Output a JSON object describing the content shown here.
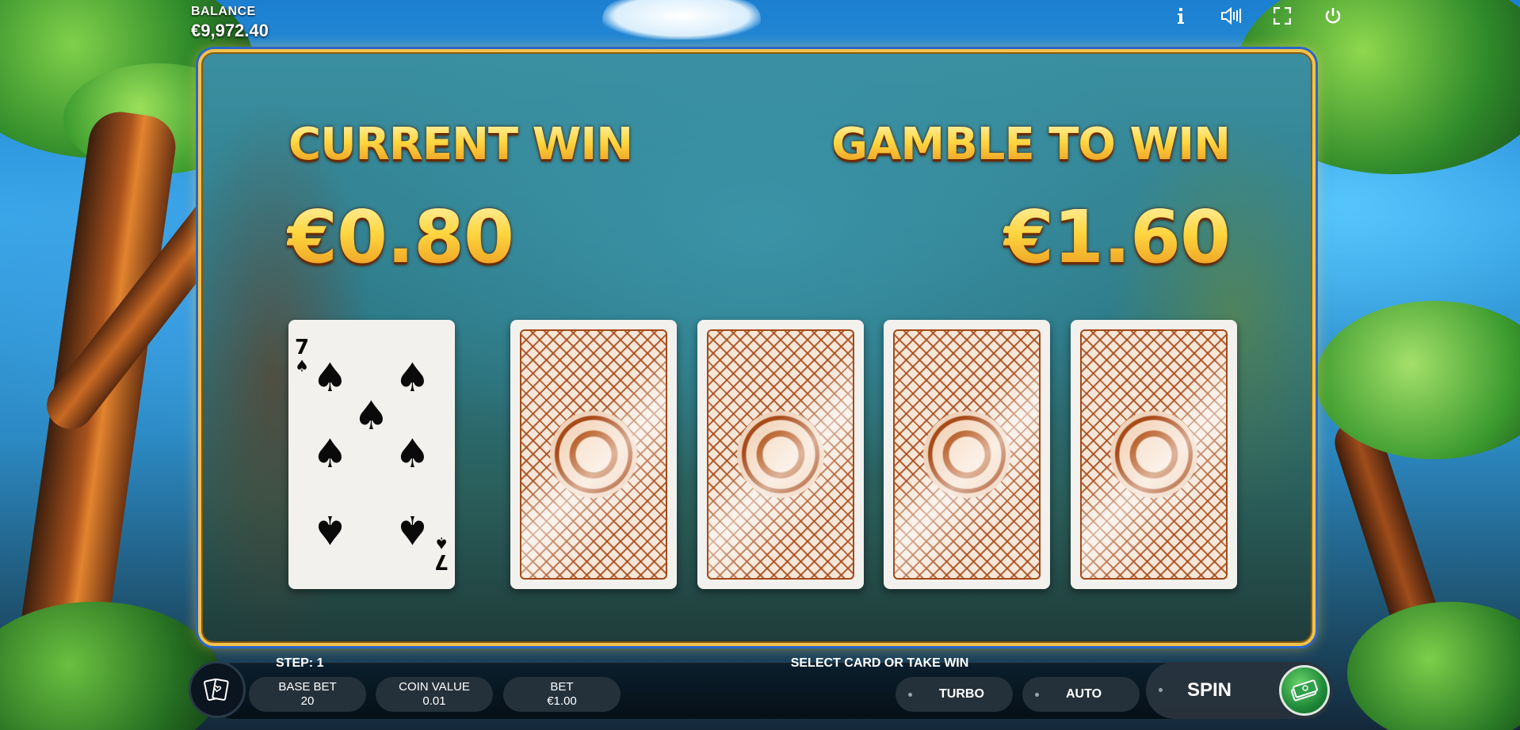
{
  "hud": {
    "balance_label": "BALANCE",
    "balance_value": "€9,972.40",
    "icons": [
      "info-icon",
      "sound-icon",
      "fullscreen-icon",
      "power-icon"
    ]
  },
  "gamble": {
    "current_win_label": "CURRENT WIN",
    "current_win_value": "€0.80",
    "gamble_to_win_label": "GAMBLE TO WIN",
    "gamble_to_win_value": "€1.60",
    "dealer_card": {
      "rank": "7",
      "suit": "spades",
      "suit_symbol": "♠"
    },
    "face_down_cards": 4
  },
  "bottom_bar": {
    "step_text": "STEP: 1",
    "message": "SELECT CARD OR TAKE WIN",
    "base_bet_label": "BASE BET",
    "base_bet_value": "20",
    "coin_value_label": "COIN VALUE",
    "coin_value_value": "0.01",
    "bet_label": "BET",
    "bet_value": "€1.00",
    "turbo_label": "TURBO",
    "auto_label": "AUTO",
    "spin_label": "SPIN"
  },
  "colors": {
    "gold": "#ffd640",
    "frame_blue": "#2a66c8",
    "card_back_red": "#a84a18",
    "spin_green": "#1f8a3a"
  }
}
